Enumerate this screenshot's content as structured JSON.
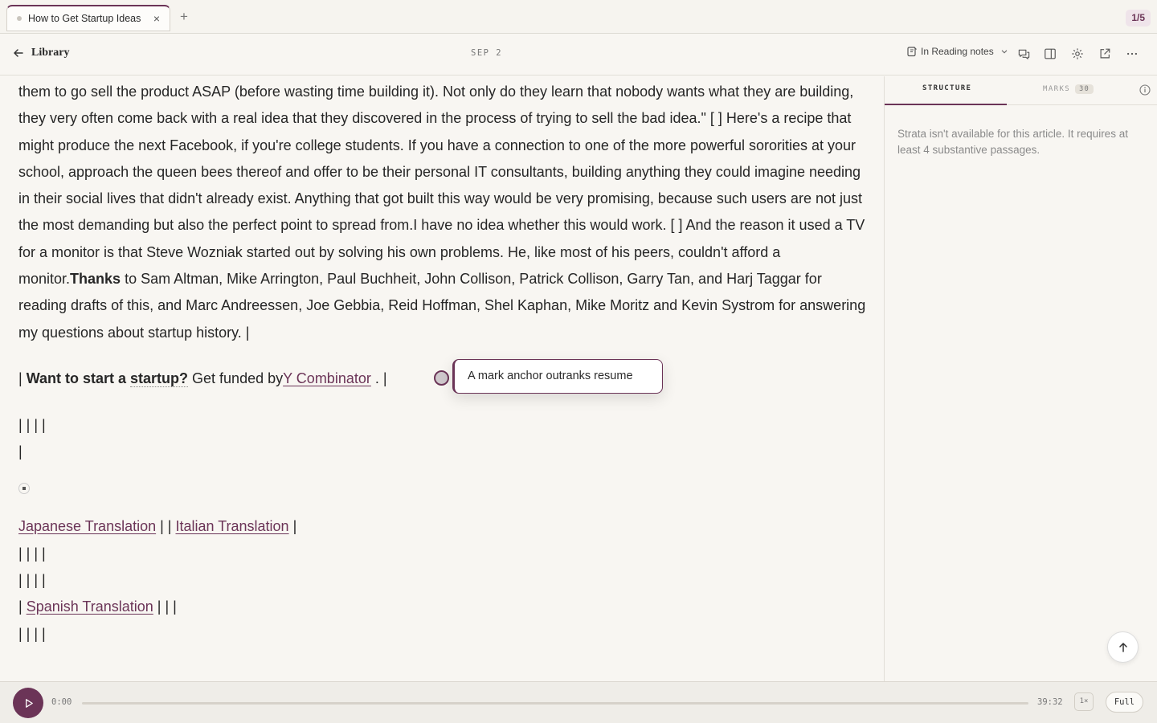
{
  "tabbar": {
    "tab_title": "How to Get Startup Ideas",
    "close_glyph": "×",
    "add_glyph": "+",
    "pager": "1/5"
  },
  "header": {
    "back_label": "Library",
    "date": "SEP 2",
    "collection": "In Reading notes",
    "icons": [
      "arrow-left-icon",
      "notes-icon",
      "chevron-down-icon",
      "comments-icon",
      "split-view-icon",
      "gear-icon",
      "external-link-icon",
      "more-icon"
    ]
  },
  "article": {
    "p1_a": "them to go sell the product ASAP (before wasting time building it). Not only do they learn that nobody wants what they are building, they very often come back with a real idea that they discovered in the process of trying to sell the bad idea.\" [ ] Here's a recipe that might produce the next Facebook, if you're college students. If you have a connection to one of the more powerful sororities at your school, approach the queen bees thereof and offer to be their personal IT consultants, building anything they could imagine needing in their social lives that didn't already exist. Anything that got built this way would be very promising, because such users are not just the most demanding but also the perfect point to spread from.I have no idea whether this would work. [ ] And the reason it used a TV for a monitor is that Steve Wozniak started out by solving his own problems. He, like most of his peers, couldn't afford a monitor.",
    "p1_bold": "Thanks",
    "p1_b": " to Sam Altman, Mike Arrington, Paul Buchheit, John Collison, Patrick Collison, Garry Tan, and Harj Taggar for reading drafts of this, and Marc Andreessen, Joe Gebbia, Reid Hoffman, Shel Kaphan, Mike Moritz and Kevin Systrom for answering my questions about startup history. |",
    "p2_pipe": "| ",
    "p2_bold_a": "Want to start a ",
    "p2_bold_b": "startup?",
    "p2_mid": " Get funded by",
    "p2_link": "Y Combinator",
    "p2_end": " . |",
    "row_a": "| | | |",
    "row_b": "|",
    "trans_ja": "Japanese Translation",
    "trans_sep": " | | ",
    "trans_it": "Italian Translation",
    "trans_end": " |",
    "row_c": "| | | |",
    "row_d": "| | | |",
    "es_pre": "| ",
    "trans_es": "Spanish Translation",
    "es_post": " | | |",
    "row_e": "| | | |",
    "tooltip": "A mark anchor outranks resume"
  },
  "side": {
    "tab_structure": "STRUCTURE",
    "tab_marks": "MARKS",
    "marks_count": "30",
    "message": "Strata isn't available for this article. It requires at least 4 substantive passages."
  },
  "player": {
    "current": "0:00",
    "duration": "39:32",
    "speed": "1×",
    "mode": "Full",
    "progress": 0
  },
  "colors": {
    "accent": "#6b3457",
    "background": "#f8f6f2"
  }
}
